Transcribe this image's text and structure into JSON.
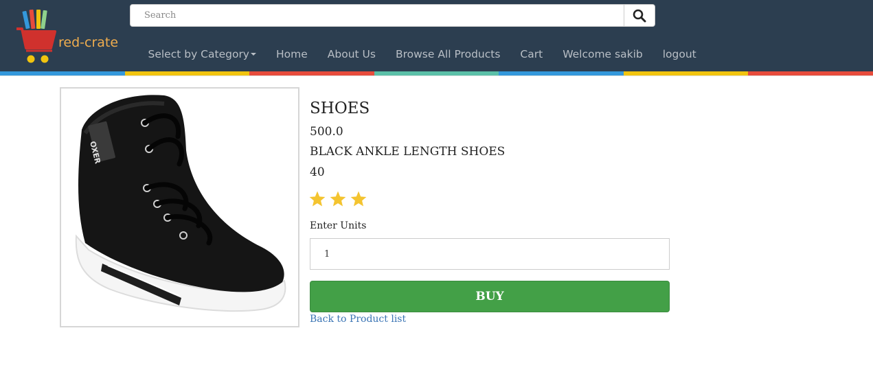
{
  "brand": {
    "name": "red-crate"
  },
  "search": {
    "placeholder": "Search"
  },
  "nav": {
    "items": [
      {
        "label": "Select by Category"
      },
      {
        "label": "Home"
      },
      {
        "label": "About Us"
      },
      {
        "label": "Browse All Products"
      },
      {
        "label": "Cart"
      },
      {
        "label": "Welcome sakib"
      },
      {
        "label": "logout"
      }
    ]
  },
  "header_colors": {
    "background": "#2c3e50",
    "strip": [
      "#3498db",
      "#f1c40f",
      "#e74c3c",
      "#5bc0a8",
      "#3498db",
      "#f1c40f",
      "#e74c3c"
    ]
  },
  "product": {
    "image_icon": "shoe-image",
    "title": "SHOES",
    "price": "500.0",
    "description": "BLACK ANKLE LENGTH SHOES",
    "size": "40",
    "rating": 3
  },
  "form": {
    "units_label": "Enter Units",
    "units_value": "1",
    "buy_label": "BUY",
    "back_label": "Back to Product list"
  },
  "colors": {
    "buy": "#43a047",
    "star": "#f4c430",
    "link": "#3a74b4"
  }
}
